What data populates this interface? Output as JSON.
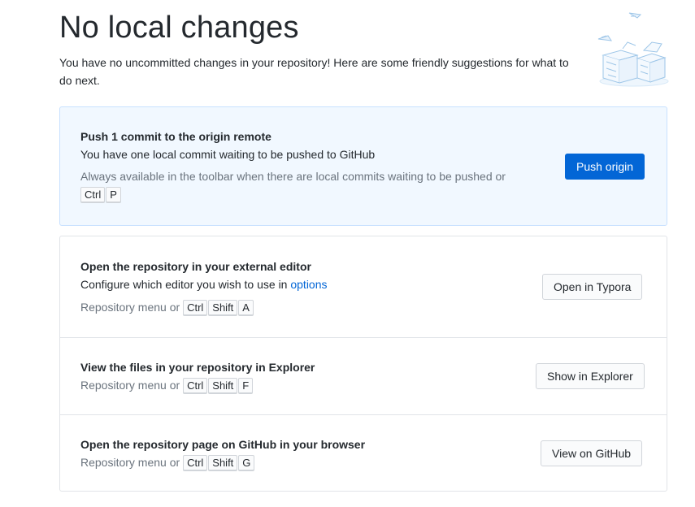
{
  "header": {
    "title": "No local changes",
    "intro": "You have no uncommitted changes in your repository! Here are some friendly suggestions for what to do next."
  },
  "push": {
    "title": "Push 1 commit to the origin remote",
    "description": "You have one local commit waiting to be pushed to GitHub",
    "hint": "Always available in the toolbar when there are local commits waiting to be pushed or",
    "keys": [
      "Ctrl",
      "P"
    ],
    "button": "Push origin"
  },
  "editor": {
    "title": "Open the repository in your external editor",
    "description_prefix": "Configure which editor you wish to use in",
    "description_link": "options",
    "hint_prefix": "Repository menu or",
    "keys": [
      "Ctrl",
      "Shift",
      "A"
    ],
    "button": "Open in Typora"
  },
  "explorer": {
    "title": "View the files in your repository in Explorer",
    "hint_prefix": "Repository menu or",
    "keys": [
      "Ctrl",
      "Shift",
      "F"
    ],
    "button": "Show in Explorer"
  },
  "github": {
    "title": "Open the repository page on GitHub in your browser",
    "hint_prefix": "Repository menu or",
    "keys": [
      "Ctrl",
      "Shift",
      "G"
    ],
    "button": "View on GitHub"
  },
  "colors": {
    "accent": "#0366d6",
    "primary_card_bg": "#f1f8ff",
    "muted_text": "#6a737d"
  },
  "icons": {
    "illustration": "empty-boxes-illustration"
  }
}
